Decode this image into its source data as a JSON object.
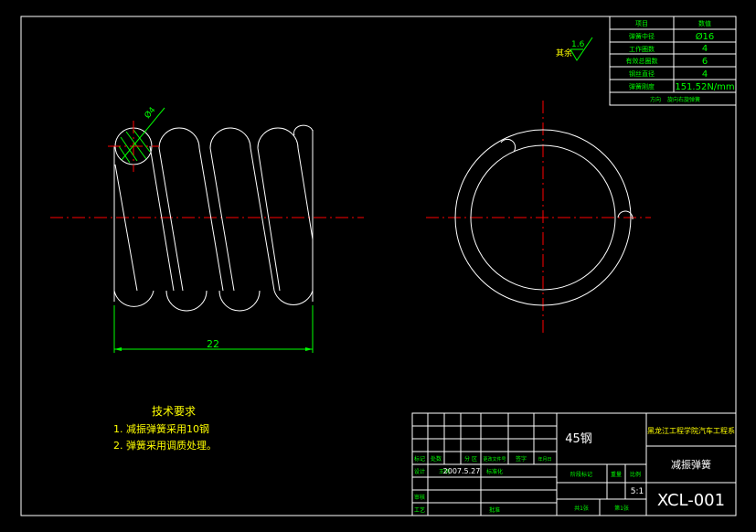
{
  "spring_params": {
    "header_item": "项目",
    "header_value": "数值",
    "rows": [
      {
        "label": "弹簧中径",
        "value": "Ø16"
      },
      {
        "label": "工作圈数",
        "value": "4"
      },
      {
        "label": "有效总圈数",
        "value": "6"
      },
      {
        "label": "钢丝直径",
        "value": "4"
      },
      {
        "label": "弹簧刚度",
        "value": "151.52N/mm"
      }
    ],
    "footer_label": "方向",
    "footer_value": "旋向右旋弹簧"
  },
  "roughness": {
    "prefix": "其余",
    "value": "1.6"
  },
  "dimensions": {
    "length": "22",
    "wire_diameter": "Ø4"
  },
  "tech_requirements": {
    "title": "技术要求",
    "items": [
      "1. 减振弹簧采用10钢",
      "2. 弹簧采用调质处理。"
    ]
  },
  "title_block": {
    "material": "45钢",
    "school": "黑龙江工程学院汽车工程系",
    "part_name": "减振弹簧",
    "drawing_no": "XCL-001",
    "scale": "5:1",
    "sheet_total": "共1张",
    "sheet_no": "第1张",
    "stage_label": "阶段标记",
    "weight_label": "重量",
    "scale_label": "比例",
    "sign_row": [
      "标记",
      "处数",
      "分 区",
      "更改文件号",
      "签字",
      "年月日"
    ],
    "designer_label": "设计",
    "designer_name": "王明",
    "date": "2007.5.27",
    "std_label": "标准化",
    "audit_label": "审核",
    "craft_label": "工艺",
    "approve_label": "批准"
  }
}
